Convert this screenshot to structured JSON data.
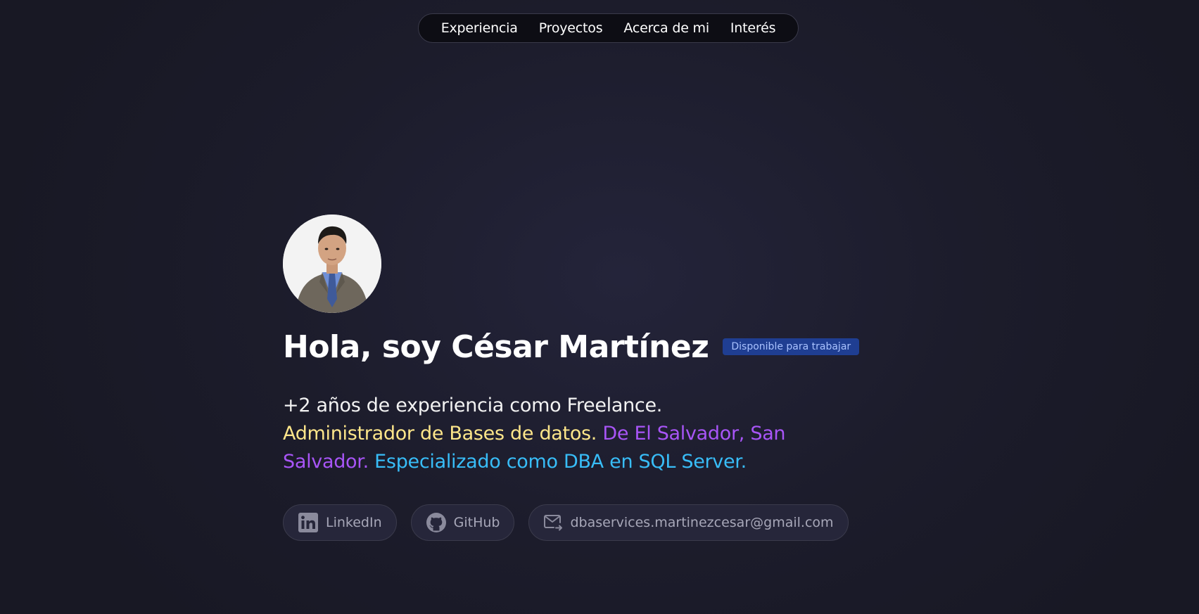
{
  "nav": {
    "items": [
      {
        "label": "Experiencia"
      },
      {
        "label": "Proyectos"
      },
      {
        "label": "Acerca de mi"
      },
      {
        "label": "Interés"
      }
    ]
  },
  "hero": {
    "title": "Hola, soy César Martínez",
    "badge": "Disponible para trabajar",
    "desc_line1": "+2 años de experiencia como Freelance.",
    "desc_role": "Administrador de Bases de datos.",
    "desc_location": "De El Salvador, San Salvador.",
    "desc_specialty": "Especializado como DBA en SQL Server."
  },
  "links": {
    "linkedin": "LinkedIn",
    "github": "GitHub",
    "email": "dbaservices.martinezcesar@gmail.com"
  },
  "colors": {
    "background": "#1c1c2b",
    "badge_bg": "#1f3e92",
    "yellow": "#fde68a",
    "purple": "#a855f7",
    "blue": "#38bdf8"
  },
  "icons": {
    "linkedin": "linkedin-icon",
    "github": "github-icon",
    "email": "mail-icon"
  }
}
